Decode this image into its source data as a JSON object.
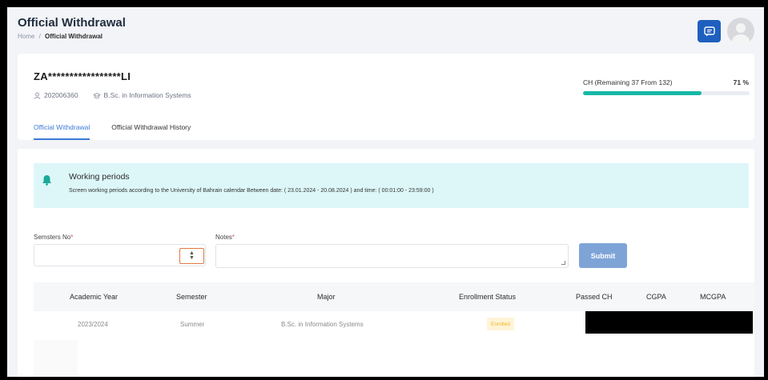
{
  "header": {
    "title": "Official Withdrawal",
    "breadcrumb": {
      "home": "Home",
      "separator": "/",
      "current": "Official Withdrawal"
    }
  },
  "profile": {
    "name": "ZA*****************LI",
    "student_id": "202006360",
    "program": "B.Sc. in Information Systems",
    "ch_label": "CH (Remaining 37 From 132)",
    "ch_percent": "71 %",
    "progress_fraction": 0.71
  },
  "tabs": [
    {
      "label": "Official Withdrawal",
      "active": true
    },
    {
      "label": "Official Withdrawal History",
      "active": false
    }
  ],
  "alert": {
    "title": "Working periods",
    "text": "Screen working periods according to the University of Bahrain calendar Between date: ( 23.01.2024 - 20.08.2024 ) and time: ( 00:01:00 - 23:59:00 )"
  },
  "form": {
    "semesters_label": "Semsters No",
    "notes_label": "Notes",
    "required_mark": "*",
    "semesters_value": "",
    "notes_value": "",
    "submit_label": "Submit"
  },
  "table": {
    "columns": [
      "Academic Year",
      "Semester",
      "Major",
      "Enrollment Status",
      "Passed CH",
      "CGPA",
      "MCGPA"
    ],
    "rows": [
      {
        "academic_year": "2023/2024",
        "semester": "Summer",
        "major": "B.Sc. in Information Systems",
        "status": "Enrolled"
      }
    ]
  },
  "colors": {
    "primary": "#3a7bd5",
    "chat_button": "#1f5fbf",
    "progress": "#17b8a6",
    "alert_bg": "#ddf7f9",
    "submit": "#7ea4d7",
    "badge_bg": "#fff4d6",
    "badge_text": "#f0b429"
  },
  "icons": {
    "chat": "chat-icon",
    "avatar": "user-avatar",
    "alert": "bell-icon",
    "id": "id-card-icon",
    "program": "graduation-cap-icon"
  }
}
